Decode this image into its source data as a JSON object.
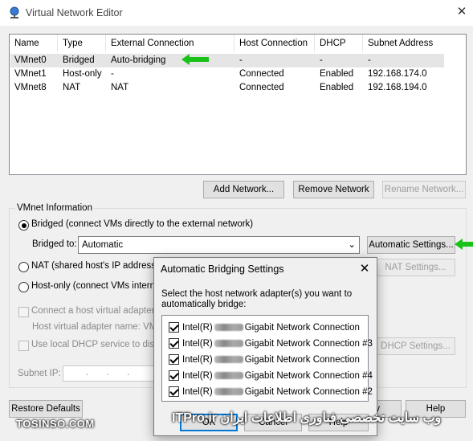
{
  "window": {
    "title": "Virtual Network Editor"
  },
  "table": {
    "headers": [
      "Name",
      "Type",
      "External Connection",
      "Host Connection",
      "DHCP",
      "Subnet Address"
    ],
    "rows": [
      [
        "VMnet0",
        "Bridged",
        "Auto-bridging",
        "-",
        "-",
        "-"
      ],
      [
        "VMnet1",
        "Host-only",
        "-",
        "Connected",
        "Enabled",
        "192.168.174.0"
      ],
      [
        "VMnet8",
        "NAT",
        "NAT",
        "Connected",
        "Enabled",
        "192.168.194.0"
      ]
    ]
  },
  "buttons": {
    "add_network": "Add Network...",
    "remove_network": "Remove Network",
    "rename_network": "Rename Network...",
    "automatic_settings": "Automatic Settings...",
    "nat_settings": "NAT Settings...",
    "dhcp_settings": "DHCP Settings...",
    "restore_defaults": "Restore Defaults",
    "apply": "y",
    "help": "Help"
  },
  "vmnet_info": {
    "group_label": "VMnet Information",
    "bridged_label": "Bridged (connect VMs directly to the external network)",
    "bridged_to_label": "Bridged to:",
    "bridged_to_value": "Automatic",
    "nat_label": "NAT (shared host's IP address w",
    "hostonly_label": "Host-only (connect VMs internal",
    "connect_adapter_label": "Connect a host virtual adapter t",
    "adapter_name_label": "Host virtual adapter name: VMw",
    "dhcp_label": "Use local DHCP service to distrib",
    "subnet_ip_label": "Subnet IP:",
    "subnet_ip_value": ".       .       ."
  },
  "dialog": {
    "title": "Automatic Bridging Settings",
    "description": "Select the host network adapter(s) you want to automatically bridge:",
    "adapters": [
      {
        "prefix": "Intel(R)",
        "suffix": "Gigabit Network Connection",
        "checked": true
      },
      {
        "prefix": "Intel(R)",
        "suffix": "Gigabit Network Connection #3",
        "checked": true
      },
      {
        "prefix": "Intel(R)",
        "suffix": "Gigabit Network Connection",
        "checked": true
      },
      {
        "prefix": "Intel(R)",
        "suffix": "Gigabit Network Connection #4",
        "checked": true
      },
      {
        "prefix": "Intel(R)",
        "suffix": "Gigabit Network Connection #2",
        "checked": true
      }
    ],
    "ok": "OK",
    "cancel": "Cancel",
    "help": "Help"
  },
  "watermark": {
    "left": "TOSINSO.COM",
    "right": "ITPro.ir وب سایت تخصصی فناوری اطلاعات ایران"
  },
  "colors": {
    "annotation_arrow": "#19c219",
    "selection": "#0078d7"
  }
}
